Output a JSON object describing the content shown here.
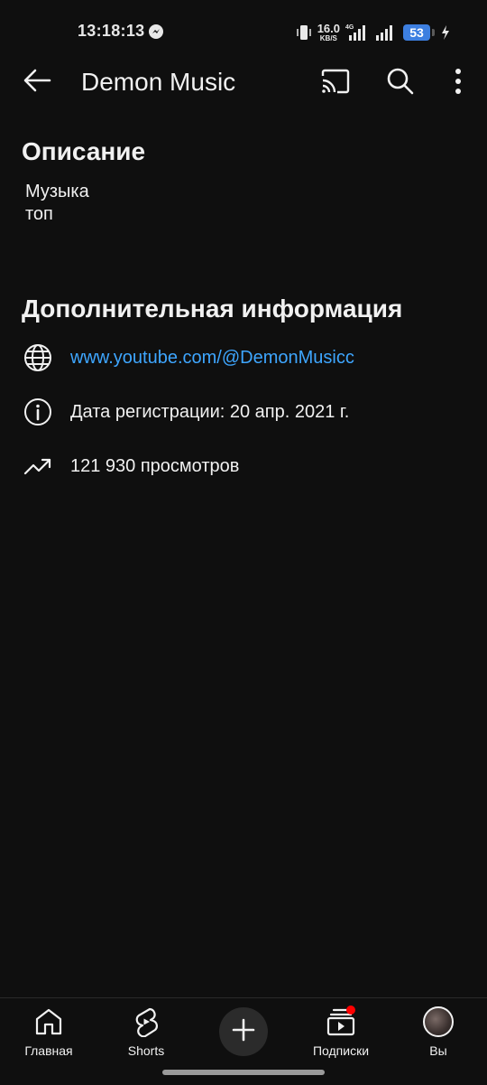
{
  "status_bar": {
    "time": "13:18:13",
    "net_speed_value": "16.0",
    "net_speed_unit": "KB/S",
    "network_type": "4G",
    "battery_level": "53"
  },
  "app_bar": {
    "title": "Demon Music",
    "icons": [
      "back-arrow-icon",
      "cast-icon",
      "search-icon",
      "more-vertical-icon"
    ]
  },
  "description": {
    "heading": "Описание",
    "text": "Музыка\nтоп"
  },
  "additional_info": {
    "heading": "Дополнительная информация",
    "link": "www.youtube.com/@DemonMusicc",
    "registration": "Дата регистрации: 20 апр. 2021 г.",
    "views": "121 930 просмотров"
  },
  "bottom_nav": {
    "home_label": "Главная",
    "shorts_label": "Shorts",
    "subscriptions_label": "Подписки",
    "you_label": "Вы"
  },
  "colors": {
    "background": "#0f0f0f",
    "link": "#3ea6ff",
    "battery": "#3d7fe0",
    "notification": "#ff0000"
  }
}
